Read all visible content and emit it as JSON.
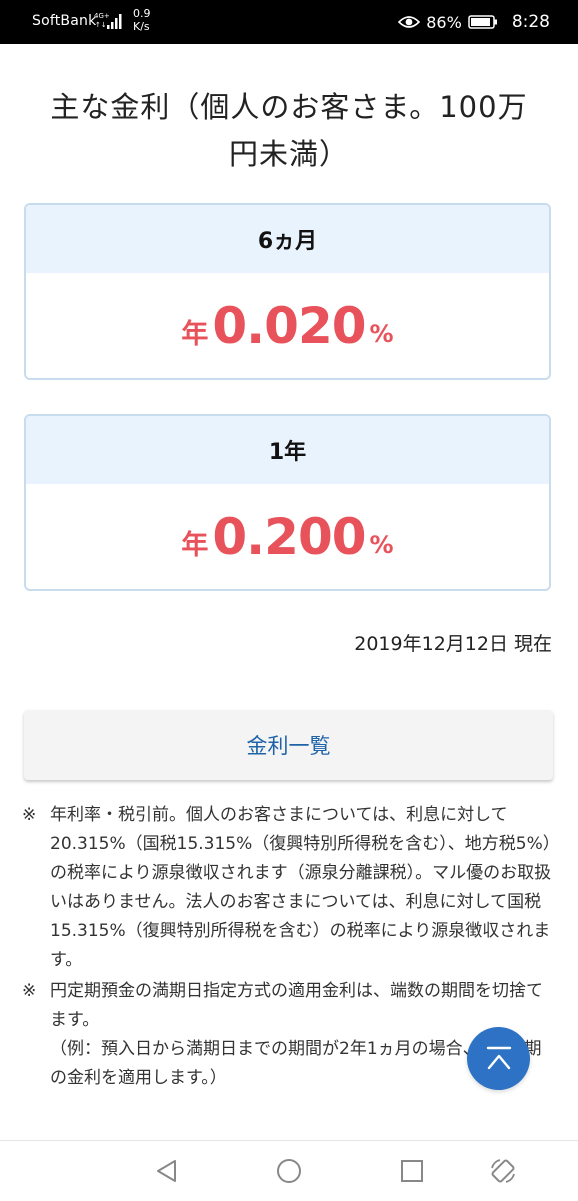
{
  "status_bar": {
    "carrier": "SoftBank",
    "network_top": "4G+",
    "network_bottom": "↑↓",
    "speed_value": "0.9",
    "speed_unit": "K/s",
    "battery": "86%",
    "time": "8:28",
    "icons": [
      "signal-icon",
      "eye-icon",
      "battery-icon"
    ]
  },
  "page": {
    "title_line1": "主な金利（個人のお客さま。100万",
    "title_line2": "円未満）"
  },
  "rates": [
    {
      "term": "6ヵ月",
      "prefix": "年",
      "value": "0.020",
      "suffix": "%"
    },
    {
      "term": "1年",
      "prefix": "年",
      "value": "0.200",
      "suffix": "%"
    }
  ],
  "as_of": "2019年12月12日 現在",
  "rate_list_button": "金利一覧",
  "notes": [
    {
      "mark": "※",
      "lines": [
        "年利率・税引前。個人のお客さまについては、利息に対して20.315%（国税15.315%（復興特別所得税を含む）、地方税5%）の税率により源泉徴収されます（源泉分離課税）。マル優のお取扱いはありません。法人のお客さまについては、利息に対して国税15.315%（復興特別所得税を含む）の税率により源泉徴収されます。"
      ]
    },
    {
      "mark": "※",
      "lines": [
        "円定期預金の満期日指定方式の適用金利は、端数の期間を切捨てます。",
        "（例：預入日から満期日までの期間が2年1ヵ月の場合、2年定期の金利を適用します。）"
      ]
    }
  ],
  "colors": {
    "accent_red": "#e8525a",
    "link_blue": "#1f63a8",
    "card_header_bg": "#e9f3fd",
    "card_border": "#c9dcee",
    "fab_blue": "#2d72c4"
  },
  "nav_icons": [
    "back-icon",
    "home-icon",
    "recents-icon",
    "rotate-icon"
  ]
}
